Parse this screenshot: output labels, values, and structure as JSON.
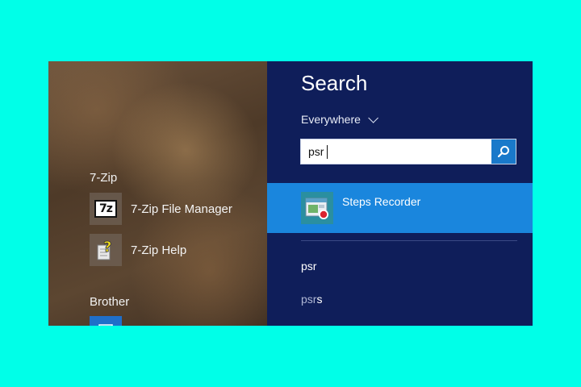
{
  "apps_panel": {
    "groups": [
      {
        "header": "7-Zip",
        "items": [
          {
            "label": "7-Zip File Manager",
            "icon": "7zip-logo-icon"
          },
          {
            "label": "7-Zip Help",
            "icon": "help-document-icon"
          }
        ]
      },
      {
        "header": "Brother",
        "items": [
          {
            "label": "",
            "icon": "brother-app-icon"
          }
        ]
      }
    ]
  },
  "search_panel": {
    "title": "Search",
    "scope": "Everywhere",
    "query": "psr",
    "top_result": {
      "label": "Steps Recorder",
      "icon": "steps-recorder-icon"
    },
    "suggestions": [
      {
        "matched": "psr",
        "rest": ""
      },
      {
        "matched": "psr",
        "rest": "s"
      }
    ]
  },
  "colors": {
    "background": "#00FFE8",
    "search_panel": "#0F1E5A",
    "selected_result": "#1A86DD",
    "search_button": "#1979CA"
  }
}
